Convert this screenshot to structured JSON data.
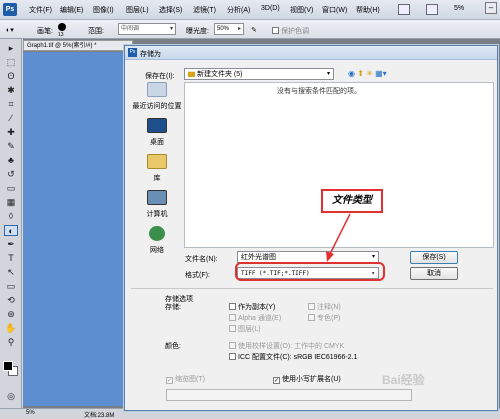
{
  "menubar": {
    "logo": "Ps",
    "items": [
      "文件(F)",
      "编辑(E)",
      "图像(I)",
      "图层(L)",
      "选择(S)",
      "滤镜(T)",
      "分析(A)",
      "3D(D)",
      "视图(V)",
      "窗口(W)",
      "帮助(H)"
    ],
    "zoom": "5%"
  },
  "options": {
    "brush_label": "画笔:",
    "brush_size": "13",
    "range_label": "范围:",
    "range_value": "中间调",
    "exposure_label": "曝光度:",
    "exposure_value": "50%",
    "protect_tones": "保护色调"
  },
  "document": {
    "tab_title": "Graph1.tif @ 5%(索引/#) *",
    "status_zoom": "5%",
    "status_doc": "文档:23.8M"
  },
  "dialog": {
    "title": "存储为",
    "save_in_label": "保存在(I):",
    "save_in_value": "新建文件夹 (5)",
    "empty_message": "没有与搜索条件匹配的项。",
    "places": [
      {
        "label": "最近访问的位置",
        "icon": "recent-places-icon"
      },
      {
        "label": "桌面",
        "icon": "desktop-icon"
      },
      {
        "label": "库",
        "icon": "library-icon"
      },
      {
        "label": "计算机",
        "icon": "computer-icon"
      },
      {
        "label": "网络",
        "icon": "network-icon"
      }
    ],
    "filename_label": "文件名(N):",
    "filename_value": "红外光谱图",
    "format_label": "格式(F):",
    "format_value": "TIFF (*.TIF;*.TIFF)",
    "save_button": "保存(S)",
    "cancel_button": "取消",
    "annotation": "文件类型",
    "save_options_title": "存储选项",
    "storage_label": "存储:",
    "options": {
      "as_copy": "作为副本(Y)",
      "alpha": "Alpha 通道(E)",
      "layers": "图层(L)",
      "notes": "注释(N)",
      "spot_colors": "专色(P)"
    },
    "color_label": "颜色:",
    "proof_setup": "使用校样设置(O): 工作中的 CMYK",
    "icc_profile": "ICC 配置文件(C): sRGB IEC61966-2.1",
    "thumbnail": "缩览图(T)",
    "lowercase_ext": "使用小写扩展名(U)"
  },
  "watermark": "Bai经验"
}
